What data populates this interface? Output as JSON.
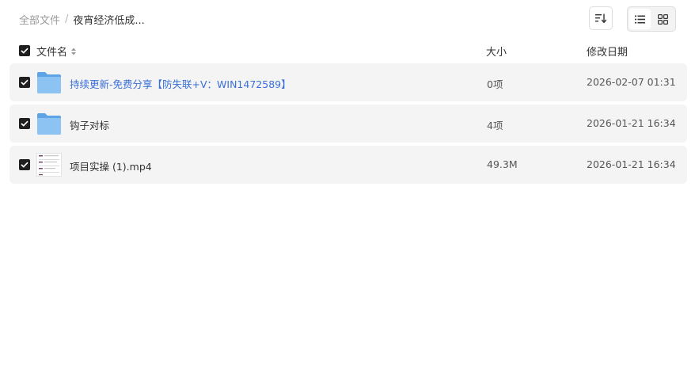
{
  "breadcrumb": {
    "root": "全部文件",
    "separator": "/",
    "current": "夜宵经济低成..."
  },
  "toolbar": {
    "sort_icon": "sort-icon",
    "list_view_icon": "list-view-icon",
    "grid_view_icon": "grid-view-icon",
    "active_view": "list"
  },
  "table": {
    "columns": {
      "name": "文件名",
      "size": "大小",
      "modified": "修改日期"
    },
    "select_all_checked": true,
    "rows": [
      {
        "type": "folder",
        "icon": "folder-icon",
        "name": "持续更新-免费分享【防失联+V：WIN1472589】",
        "size": "0项",
        "modified": "2026-02-07 01:31",
        "checked": true,
        "highlight": true
      },
      {
        "type": "folder",
        "icon": "folder-icon",
        "name": "钩子对标",
        "size": "4项",
        "modified": "2026-01-21 16:34",
        "checked": true,
        "highlight": false
      },
      {
        "type": "video",
        "icon": "video-thumbnail",
        "name": "项目实操 (1).mp4",
        "size": "49.3M",
        "modified": "2026-01-21 16:34",
        "checked": true,
        "highlight": false
      }
    ]
  },
  "colors": {
    "checkbox": "#1f1f1f",
    "row_background": "#f4f4f4",
    "link": "#3a6fd8",
    "folder": "#7fb8ee"
  }
}
